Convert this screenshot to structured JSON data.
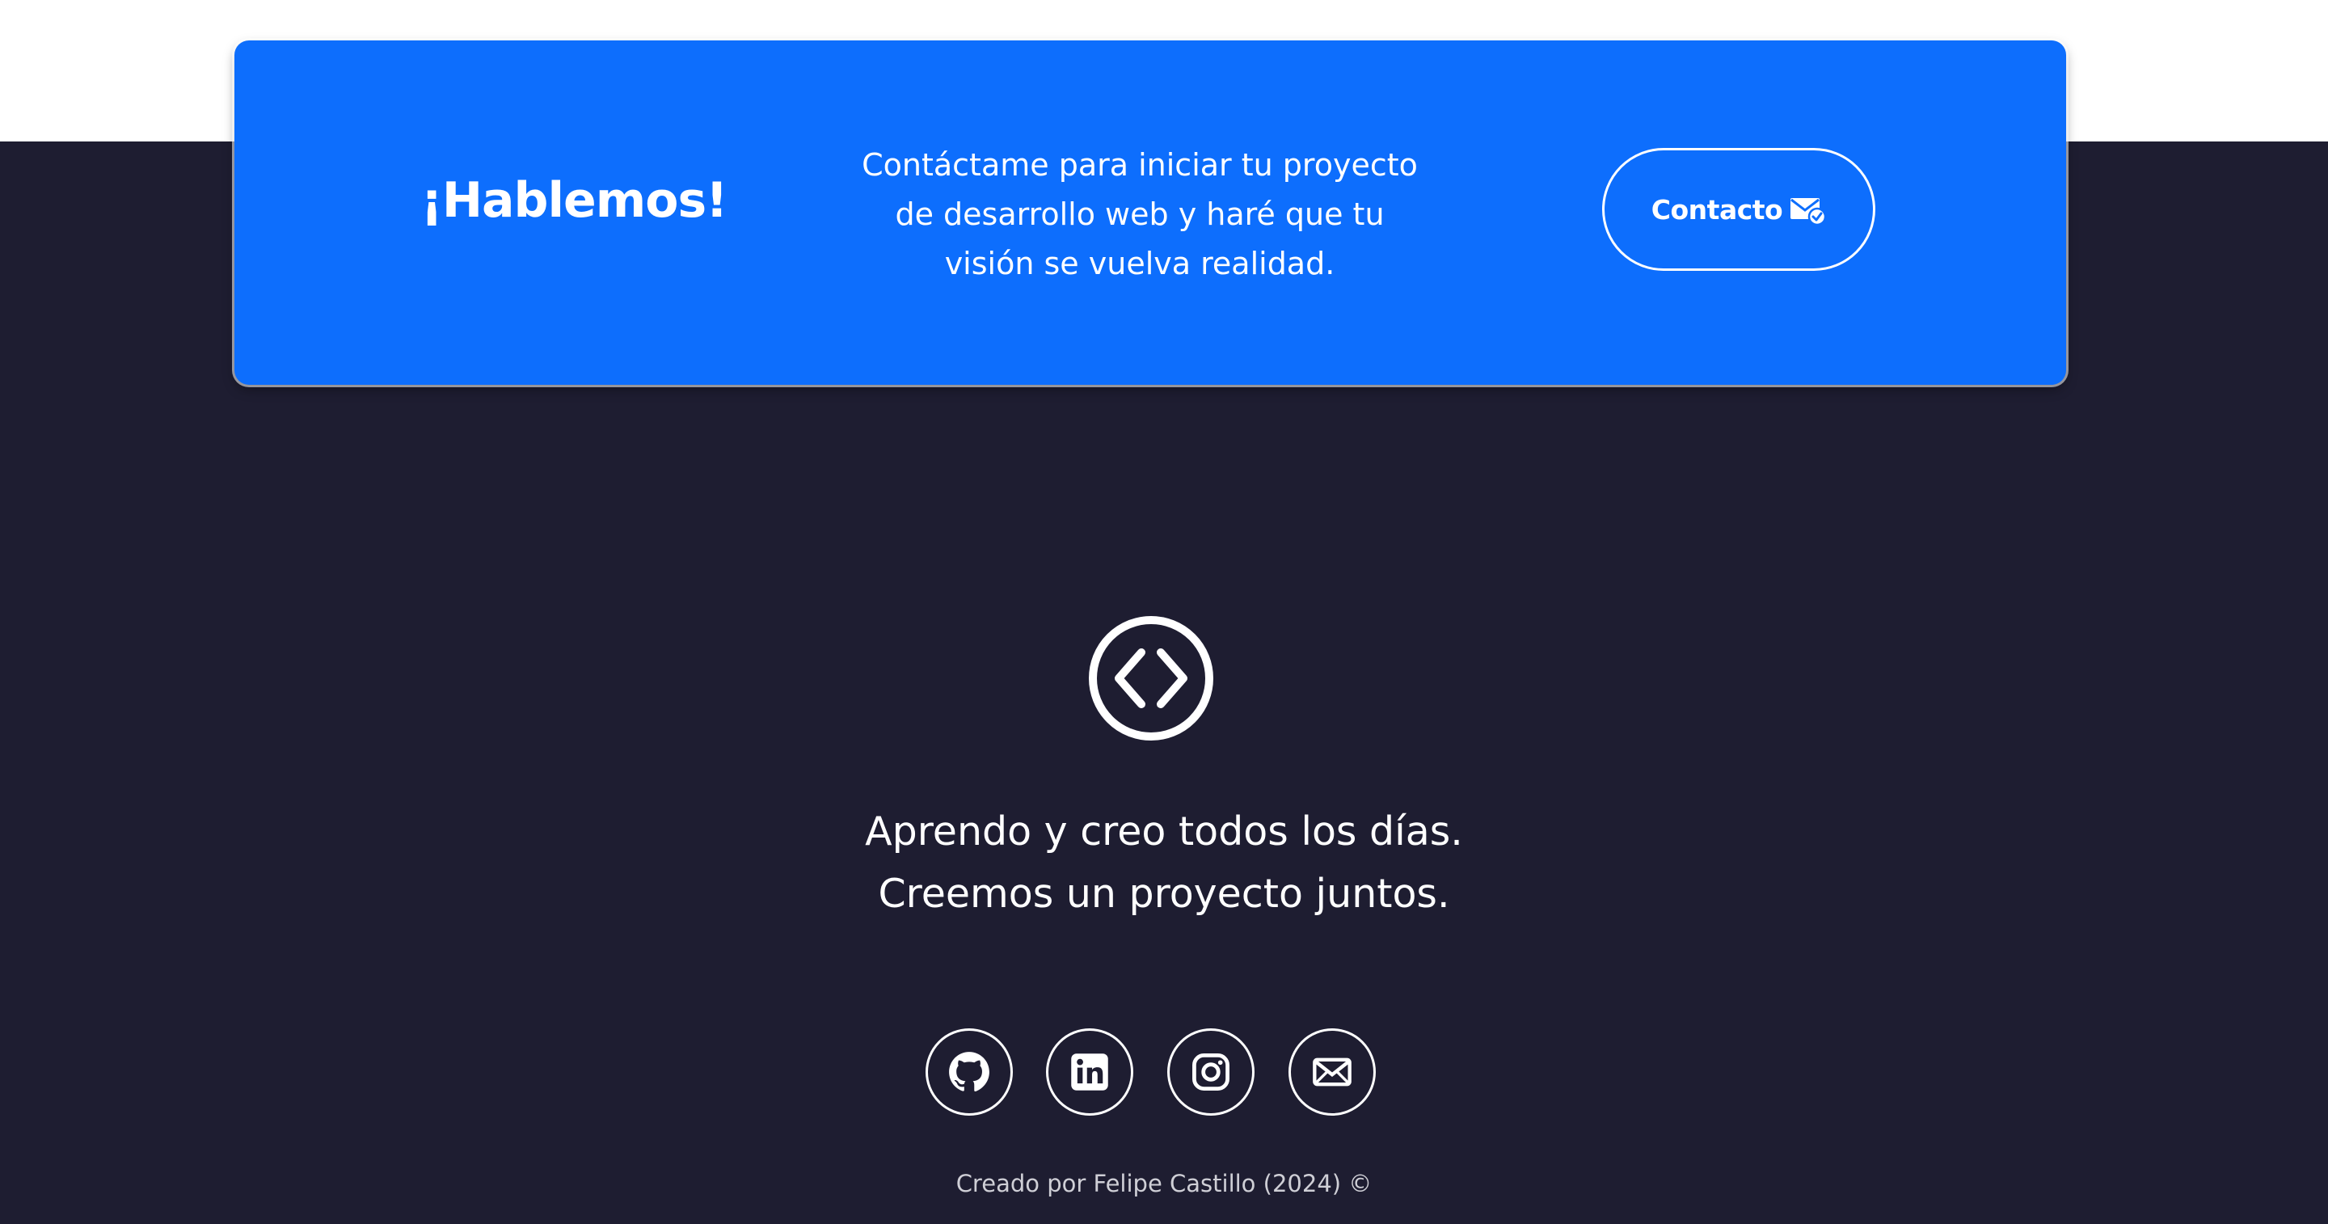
{
  "cta": {
    "title": "¡Hablemos!",
    "text": "Contáctame para iniciar tu proyecto de desarrollo web y haré que tu visión se vuelva realidad.",
    "button_label": "Contacto",
    "button_icon": "mail-check-icon"
  },
  "footer": {
    "logo_icon": "code-circle-icon",
    "tagline_line1": "Aprendo y creo todos los días.",
    "tagline_line2": "Creemos un proyecto juntos.",
    "socials": [
      {
        "icon": "github-icon"
      },
      {
        "icon": "linkedin-icon"
      },
      {
        "icon": "instagram-icon"
      },
      {
        "icon": "email-icon"
      }
    ],
    "copyright": "Creado por Felipe Castillo (2024) ©"
  },
  "colors": {
    "background": "#ffffff",
    "footer_bg": "#1e1d31",
    "card_blue": "#0d6efd",
    "text_light": "#ffffff",
    "text_muted": "#cfcfd6"
  }
}
